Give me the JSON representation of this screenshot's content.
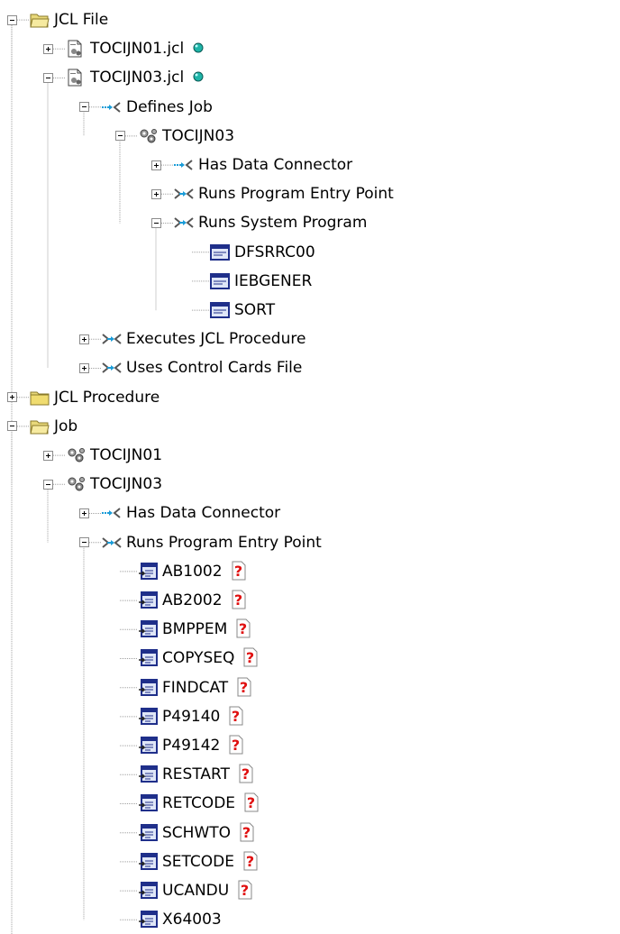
{
  "tree": {
    "nodes": [
      {
        "label": "JCL File",
        "level": 0,
        "icon": "folder-open-icon",
        "toggle": "minus"
      },
      {
        "label": "TOCIJN01.jcl",
        "level": 1,
        "icon": "jcl-file-icon",
        "toggle": "plus",
        "badge": "status-dot-icon"
      },
      {
        "label": "TOCIJN03.jcl",
        "level": 1,
        "icon": "jcl-file-icon",
        "toggle": "minus",
        "badge": "status-dot-icon"
      },
      {
        "label": "Defines Job",
        "level": 2,
        "icon": "relation-single-icon",
        "toggle": "minus"
      },
      {
        "label": "TOCIJN03",
        "level": 3,
        "icon": "gears-icon",
        "toggle": "minus"
      },
      {
        "label": "Has Data Connector",
        "level": 4,
        "icon": "relation-single-icon",
        "toggle": "plus"
      },
      {
        "label": "Runs Program Entry Point",
        "level": 4,
        "icon": "relation-multi-icon",
        "toggle": "plus"
      },
      {
        "label": "Runs System Program",
        "level": 4,
        "icon": "relation-multi-icon",
        "toggle": "minus"
      },
      {
        "label": "DFSRRC00",
        "level": 5,
        "icon": "system-program-icon",
        "toggle": "none"
      },
      {
        "label": "IEBGENER",
        "level": 5,
        "icon": "system-program-icon",
        "toggle": "none"
      },
      {
        "label": "SORT",
        "level": 5,
        "icon": "system-program-icon",
        "toggle": "none"
      },
      {
        "label": "Executes JCL Procedure",
        "level": 2,
        "icon": "relation-multi-icon",
        "toggle": "plus"
      },
      {
        "label": "Uses Control Cards File",
        "level": 2,
        "icon": "relation-multi-icon",
        "toggle": "plus"
      },
      {
        "label": "JCL Procedure",
        "level": 0,
        "icon": "folder-closed-icon",
        "toggle": "plus"
      },
      {
        "label": "Job",
        "level": 0,
        "icon": "folder-open-icon",
        "toggle": "minus"
      },
      {
        "label": "TOCIJN01",
        "level": 1,
        "icon": "gears-icon",
        "toggle": "plus"
      },
      {
        "label": "TOCIJN03",
        "level": 1,
        "icon": "gears-icon",
        "toggle": "minus"
      },
      {
        "label": "Has Data Connector",
        "level": 2,
        "icon": "relation-single-icon",
        "toggle": "plus"
      },
      {
        "label": "Runs Program Entry Point",
        "level": 2,
        "icon": "relation-multi-icon",
        "toggle": "minus"
      },
      {
        "label": "AB1002",
        "level": 3,
        "icon": "program-entry-icon",
        "toggle": "none",
        "badge": "help-question-icon"
      },
      {
        "label": "AB2002",
        "level": 3,
        "icon": "program-entry-icon",
        "toggle": "none",
        "badge": "help-question-icon"
      },
      {
        "label": "BMPPEM",
        "level": 3,
        "icon": "program-entry-icon",
        "toggle": "none",
        "badge": "help-question-icon"
      },
      {
        "label": "COPYSEQ",
        "level": 3,
        "icon": "program-entry-icon",
        "toggle": "none",
        "badge": "help-question-icon"
      },
      {
        "label": "FINDCAT",
        "level": 3,
        "icon": "program-entry-icon",
        "toggle": "none",
        "badge": "help-question-icon"
      },
      {
        "label": "P49140",
        "level": 3,
        "icon": "program-entry-icon",
        "toggle": "none",
        "badge": "help-question-icon"
      },
      {
        "label": "P49142",
        "level": 3,
        "icon": "program-entry-icon",
        "toggle": "none",
        "badge": "help-question-icon"
      },
      {
        "label": "RESTART",
        "level": 3,
        "icon": "program-entry-icon",
        "toggle": "none",
        "badge": "help-question-icon"
      },
      {
        "label": "RETCODE",
        "level": 3,
        "icon": "program-entry-icon",
        "toggle": "none",
        "badge": "help-question-icon"
      },
      {
        "label": "SCHWTO",
        "level": 3,
        "icon": "program-entry-icon",
        "toggle": "none",
        "badge": "help-question-icon"
      },
      {
        "label": "SETCODE",
        "level": 3,
        "icon": "program-entry-icon",
        "toggle": "none",
        "badge": "help-question-icon"
      },
      {
        "label": "UCANDU",
        "level": 3,
        "icon": "program-entry-icon",
        "toggle": "none",
        "badge": "help-question-icon"
      },
      {
        "label": "X64003",
        "level": 3,
        "icon": "program-entry-icon",
        "toggle": "none"
      }
    ]
  },
  "colors": {
    "tree_line": "#a0a0a0",
    "folder": "#e8d87a",
    "status_dot": "#1fb5a8",
    "relation_arrow": "#1a9cd8",
    "program_icon": "#1f2f8a",
    "help_red": "#e01010"
  }
}
